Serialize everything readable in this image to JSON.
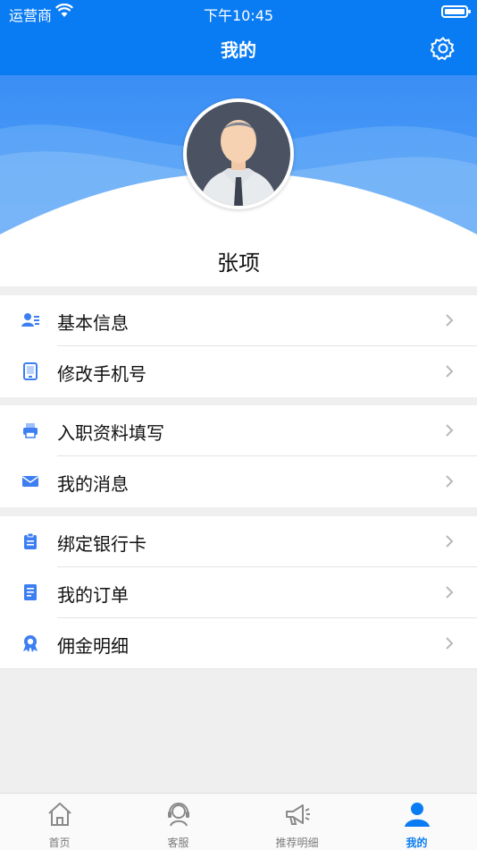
{
  "status_bar": {
    "carrier": "运营商",
    "time": "下午10:45"
  },
  "nav": {
    "title": "我的",
    "settings_icon": "gear-icon"
  },
  "profile": {
    "name": "张项",
    "avatar_icon": "user-avatar"
  },
  "colors": {
    "primary": "#0a7cf3",
    "icon_blue": "#3d7ff2",
    "background": "#efefef"
  },
  "menu_groups": [
    {
      "items": [
        {
          "label": "基本信息",
          "icon": "id-card-icon"
        },
        {
          "label": "修改手机号",
          "icon": "phone-icon"
        }
      ]
    },
    {
      "items": [
        {
          "label": "入职资料填写",
          "icon": "printer-icon"
        },
        {
          "label": "我的消息",
          "icon": "envelope-icon"
        }
      ]
    },
    {
      "items": [
        {
          "label": "绑定银行卡",
          "icon": "clipboard-icon"
        },
        {
          "label": "我的订单",
          "icon": "document-icon"
        },
        {
          "label": "佣金明细",
          "icon": "award-icon"
        }
      ]
    }
  ],
  "tabbar": {
    "items": [
      {
        "label": "首页",
        "icon": "home-icon",
        "active": false
      },
      {
        "label": "客服",
        "icon": "headset-icon",
        "active": false
      },
      {
        "label": "推荐明细",
        "icon": "megaphone-icon",
        "active": false
      },
      {
        "label": "我的",
        "icon": "person-icon",
        "active": true
      }
    ]
  }
}
